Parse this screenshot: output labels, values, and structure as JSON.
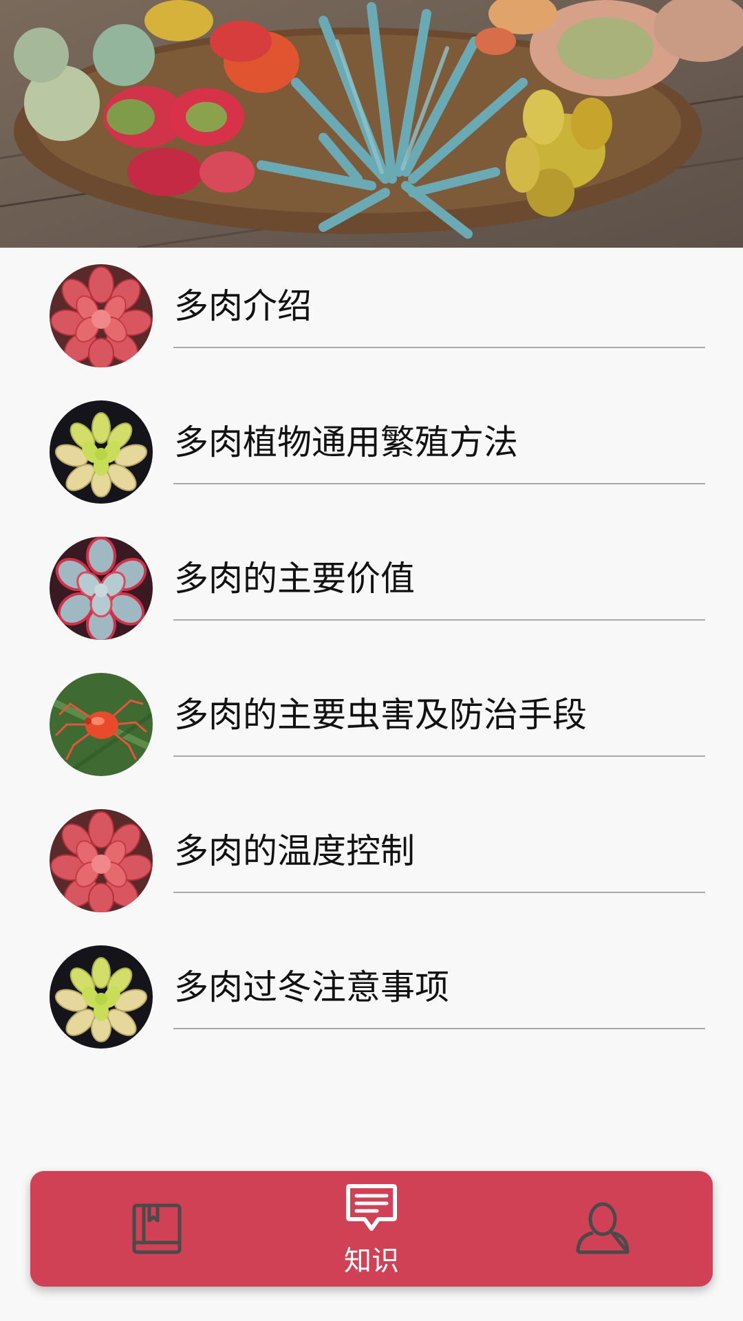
{
  "list": {
    "items": [
      {
        "label": "多肉介绍",
        "thumbnail": "red-succulent"
      },
      {
        "label": "多肉植物通用繁殖方法",
        "thumbnail": "yellow-succulent"
      },
      {
        "label": "多肉的主要价值",
        "thumbnail": "blue-red-succulent"
      },
      {
        "label": "多肉的主要虫害及防治手段",
        "thumbnail": "red-spider-mite"
      },
      {
        "label": "多肉的温度控制",
        "thumbnail": "red-succulent"
      },
      {
        "label": "多肉过冬注意事项",
        "thumbnail": "yellow-succulent"
      }
    ]
  },
  "bottom_nav": {
    "items": [
      {
        "icon": "book-icon",
        "label": ""
      },
      {
        "icon": "chat-message-icon",
        "label": "知识",
        "active": true
      },
      {
        "icon": "user-icon",
        "label": ""
      }
    ]
  },
  "colors": {
    "nav_background": "#d04156",
    "page_background": "#f8f8f9",
    "divider": "#a9a9a9",
    "inactive_icon": "#4a4a4a",
    "active_icon": "#ffffff"
  }
}
